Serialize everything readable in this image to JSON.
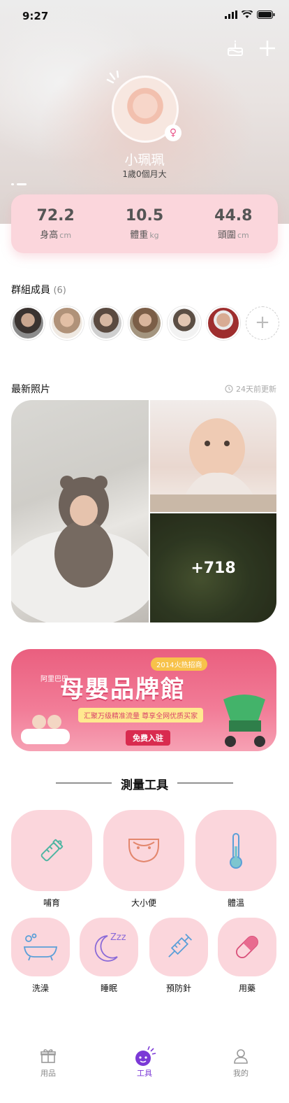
{
  "status_bar": {
    "time": "9:27"
  },
  "profile": {
    "name": "小珮珮",
    "age": "1歲0個月大",
    "gender_symbol": "♀"
  },
  "stats": [
    {
      "value": "72.2",
      "label": "身高",
      "unit": "cm"
    },
    {
      "value": "10.5",
      "label": "體重",
      "unit": "kg"
    },
    {
      "value": "44.8",
      "label": "頭圍",
      "unit": "cm"
    }
  ],
  "group": {
    "title": "群組成員",
    "count": "(6)",
    "add_symbol": "+"
  },
  "photos": {
    "title": "最新照片",
    "updated": "24天前更新",
    "more_count": "+718"
  },
  "banner": {
    "brand": "阿里巴巴",
    "title": "母嬰品牌館",
    "year_tag": "2014火热招商",
    "subtitle": "汇聚万级精准流量   尊享全网优质买家",
    "button": "免费入驻"
  },
  "tools": {
    "heading": "測量工具",
    "items": [
      {
        "label": "哺育"
      },
      {
        "label": "大小便"
      },
      {
        "label": "體溫"
      },
      {
        "label": "洗澡"
      },
      {
        "label": "睡眠"
      },
      {
        "label": "預防針"
      },
      {
        "label": "用藥"
      }
    ]
  },
  "tabbar": [
    {
      "label": "用品"
    },
    {
      "label": "工具"
    },
    {
      "label": "我的"
    }
  ],
  "colors": {
    "tile_pink": "#fbd6dc",
    "accent_purple": "#7b39d6",
    "female_pink": "#e9568a"
  }
}
